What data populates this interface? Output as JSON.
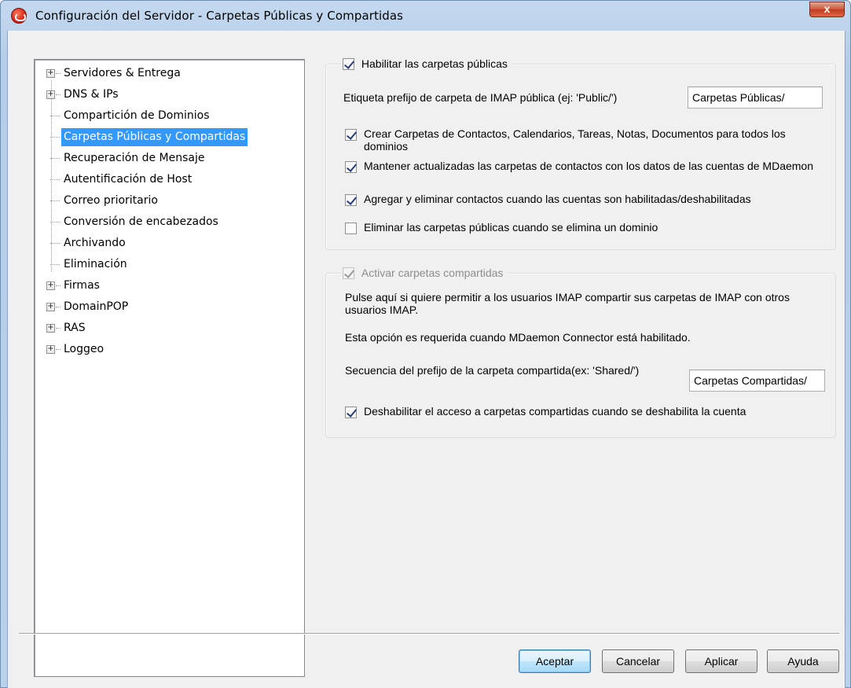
{
  "window": {
    "title": "Configuración del Servidor - Carpetas Públicas y Compartidas",
    "close_label": "x"
  },
  "tree": {
    "items": [
      {
        "label": "Servidores & Entrega",
        "expandable": true,
        "expander": "+"
      },
      {
        "label": "DNS & IPs",
        "expandable": true,
        "expander": "+"
      },
      {
        "label": "Compartición de Dominios",
        "expandable": false
      },
      {
        "label": "Carpetas Públicas y Compartidas",
        "expandable": false,
        "selected": true
      },
      {
        "label": "Recuperación de Mensaje",
        "expandable": false
      },
      {
        "label": "Autentificación de Host",
        "expandable": false
      },
      {
        "label": "Correo prioritario",
        "expandable": false
      },
      {
        "label": "Conversión de encabezados",
        "expandable": false
      },
      {
        "label": "Archivando",
        "expandable": false
      },
      {
        "label": "Eliminación",
        "expandable": false
      },
      {
        "label": "Firmas",
        "expandable": true,
        "expander": "+"
      },
      {
        "label": "DomainPOP",
        "expandable": true,
        "expander": "+"
      },
      {
        "label": "RAS",
        "expandable": true,
        "expander": "+"
      },
      {
        "label": "Loggeo",
        "expandable": true,
        "expander": "+"
      }
    ]
  },
  "public_folders": {
    "enable_label": "Habilitar las carpetas públicas",
    "enable_checked": true,
    "prefix_label": "Etiqueta prefijo de carpeta de IMAP pública (ej: 'Public/')",
    "prefix_value": "Carpetas Públicas/",
    "create_folders_label": "Crear Carpetas de Contactos, Calendarios, Tareas, Notas, Documentos para todos los dominios",
    "create_folders_checked": true,
    "keep_updated_label": "Mantener actualizadas las carpetas de contactos con los datos de las cuentas de MDaemon",
    "keep_updated_checked": true,
    "add_remove_label": "Agregar y eliminar contactos cuando las cuentas son habilitadas/deshabilitadas",
    "add_remove_checked": true,
    "delete_on_domain_label": "Eliminar las carpetas públicas cuando se elimina un dominio",
    "delete_on_domain_checked": false
  },
  "shared_folders": {
    "enable_label": "Activar carpetas compartidas",
    "enable_checked": true,
    "description_1": "Pulse aquí si quiere permitir a los usuarios IMAP compartir sus carpetas de IMAP con otros usuarios IMAP.",
    "description_2": "Esta opción es requerida cuando MDaemon Connector está habilitado.",
    "prefix_label": "Secuencia del prefijo de la carpeta compartida(ex: 'Shared/')",
    "prefix_value": "Carpetas Compartidas/",
    "disable_access_label": "Deshabilitar el acceso a carpetas compartidas cuando se deshabilita la cuenta",
    "disable_access_checked": true
  },
  "buttons": {
    "accept": "Aceptar",
    "cancel": "Cancelar",
    "apply": "Aplicar",
    "help": "Ayuda"
  }
}
